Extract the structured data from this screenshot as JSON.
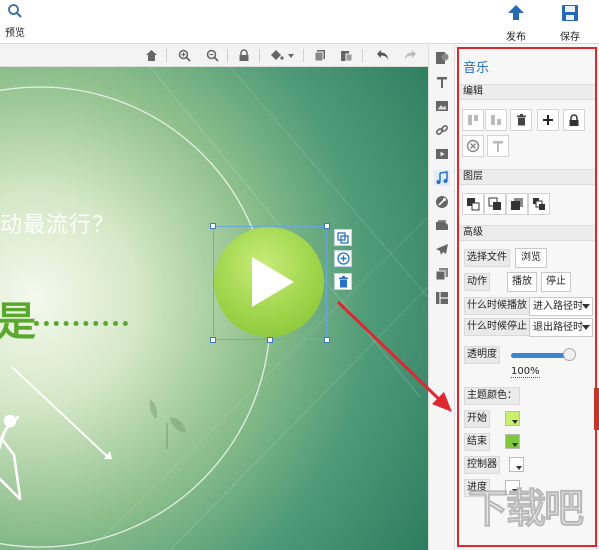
{
  "toolbar": {
    "preview_label": "预览",
    "publish_label": "发布",
    "save_label": "保存"
  },
  "slide": {
    "question_text": "动最流行？",
    "big_char": "是"
  },
  "panel": {
    "title": "音乐",
    "edit_section": "编辑",
    "layer_section": "图层",
    "advanced_section": "高级",
    "select_file_label": "选择文件",
    "browse_button": "浏览",
    "action_label": "动作",
    "play_button": "播放",
    "stop_button": "停止",
    "when_play_label": "什么时候播放",
    "when_play_value": "进入路径时",
    "when_stop_label": "什么时候停止",
    "when_stop_value": "退出路径时",
    "opacity_label": "透明度",
    "opacity_value": "100%",
    "opacity_fraction": 1.0,
    "theme_color_label": "主题颜色：",
    "start_label": "开始",
    "start_color": "#c8ef6e",
    "end_label": "结束",
    "end_color": "#7fc83c",
    "controller_label": "控制器",
    "controller_color": "#ffffff",
    "progress_label": "进度",
    "progress_color": "#ffffff"
  },
  "colors": {
    "accent_blue": "#2a72c4",
    "annotation_red": "#e0262f",
    "play_green": "#9ed44a"
  },
  "watermark": {
    "text": "下载吧"
  }
}
